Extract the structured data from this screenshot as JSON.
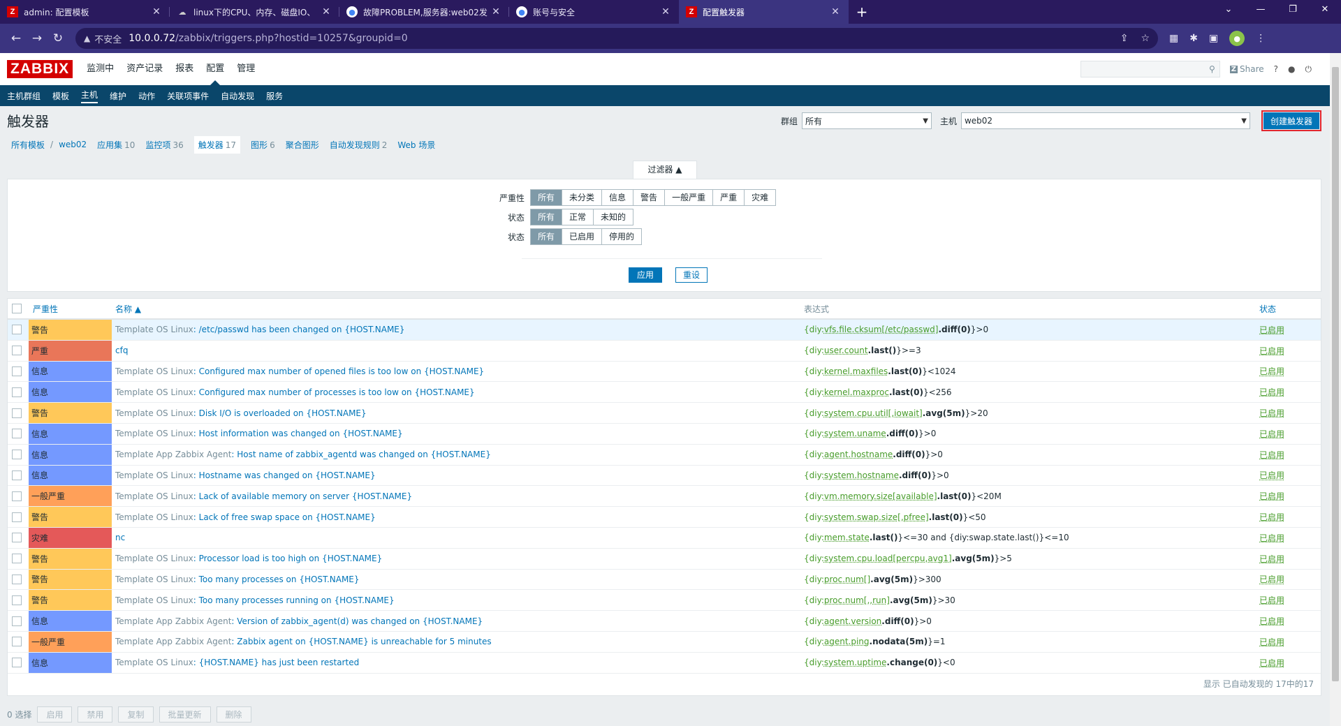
{
  "browser": {
    "tabs": [
      {
        "icon": "zabbix-favicon",
        "title": "admin: 配置模板",
        "active": false
      },
      {
        "icon": "cloud-favicon",
        "title": "linux下的CPU、内存、磁盘IO、",
        "active": false
      },
      {
        "icon": "chrome-favicon",
        "title": "故障PROBLEM,服务器:web02发",
        "active": false
      },
      {
        "icon": "chrome-favicon",
        "title": "账号与安全",
        "active": false
      },
      {
        "icon": "zabbix-favicon",
        "title": "配置触发器",
        "active": true
      }
    ],
    "insecure_label": "不安全",
    "url_host": "10.0.0.72",
    "url_path": "/zabbix/triggers.php?hostid=10257&groupid=0"
  },
  "app": {
    "logo": "ZABBIX",
    "main_menu": [
      "监测中",
      "资产记录",
      "报表",
      "配置",
      "管理"
    ],
    "main_menu_selected": "配置",
    "share_label": "Share",
    "sub_menu": [
      "主机群组",
      "模板",
      "主机",
      "维护",
      "动作",
      "关联项事件",
      "自动发现",
      "服务"
    ],
    "sub_menu_selected": "主机",
    "page_title": "触发器",
    "group_label": "群组",
    "group_value": "所有",
    "host_label": "主机",
    "host_value": "web02",
    "create_button": "创建触发器",
    "breadcrumbs": {
      "all_templates": "所有模板",
      "host": "web02",
      "apps": "应用集",
      "apps_count": "10",
      "items": "监控项",
      "items_count": "36",
      "triggers": "触发器",
      "triggers_count": "17",
      "graphs": "图形",
      "graphs_count": "6",
      "screens": "聚合图形",
      "discovery": "自动发现规则",
      "discovery_count": "2",
      "web": "Web 场景"
    },
    "filter": {
      "tab_label": "过滤器 ▲",
      "severity_label": "严重性",
      "severity_options": [
        "所有",
        "未分类",
        "信息",
        "警告",
        "一般严重",
        "严重",
        "灾难"
      ],
      "state_label": "状态",
      "state_options": [
        "所有",
        "正常",
        "未知的"
      ],
      "status_label": "状态",
      "status_options": [
        "所有",
        "已启用",
        "停用的"
      ],
      "apply": "应用",
      "reset": "重设"
    },
    "table": {
      "headers": {
        "severity": "严重性",
        "name": "名称 ▲",
        "expression": "表达式",
        "status": "状态"
      },
      "rows": [
        {
          "sev": "警告",
          "tpl": "Template OS Linux",
          "name": "/etc/passwd has been changed on {HOST.NAME}",
          "host": "{diy:",
          "key": "vfs.file.cksum[/etc/passwd]",
          "fn": ".diff(0)",
          "rest": "}>0",
          "status": "已启用"
        },
        {
          "sev": "严重",
          "tpl": "",
          "name": "cfq",
          "host": "{diy:",
          "key": "user.count",
          "fn": ".last()",
          "rest": "}>=3",
          "status": "已启用"
        },
        {
          "sev": "信息",
          "tpl": "Template OS Linux",
          "name": "Configured max number of opened files is too low on {HOST.NAME}",
          "host": "{diy:",
          "key": "kernel.maxfiles",
          "fn": ".last(0)",
          "rest": "}<1024",
          "status": "已启用"
        },
        {
          "sev": "信息",
          "tpl": "Template OS Linux",
          "name": "Configured max number of processes is too low on {HOST.NAME}",
          "host": "{diy:",
          "key": "kernel.maxproc",
          "fn": ".last(0)",
          "rest": "}<256",
          "status": "已启用"
        },
        {
          "sev": "警告",
          "tpl": "Template OS Linux",
          "name": "Disk I/O is overloaded on {HOST.NAME}",
          "host": "{diy:",
          "key": "system.cpu.util[,iowait]",
          "fn": ".avg(5m)",
          "rest": "}>20",
          "status": "已启用"
        },
        {
          "sev": "信息",
          "tpl": "Template OS Linux",
          "name": "Host information was changed on {HOST.NAME}",
          "host": "{diy:",
          "key": "system.uname",
          "fn": ".diff(0)",
          "rest": "}>0",
          "status": "已启用"
        },
        {
          "sev": "信息",
          "tpl": "Template App Zabbix Agent",
          "name": "Host name of zabbix_agentd was changed on {HOST.NAME}",
          "host": "{diy:",
          "key": "agent.hostname",
          "fn": ".diff(0)",
          "rest": "}>0",
          "status": "已启用"
        },
        {
          "sev": "信息",
          "tpl": "Template OS Linux",
          "name": "Hostname was changed on {HOST.NAME}",
          "host": "{diy:",
          "key": "system.hostname",
          "fn": ".diff(0)",
          "rest": "}>0",
          "status": "已启用"
        },
        {
          "sev": "一般严重",
          "tpl": "Template OS Linux",
          "name": "Lack of available memory on server {HOST.NAME}",
          "host": "{diy:",
          "key": "vm.memory.size[available]",
          "fn": ".last(0)",
          "rest": "}<20M",
          "status": "已启用"
        },
        {
          "sev": "警告",
          "tpl": "Template OS Linux",
          "name": "Lack of free swap space on {HOST.NAME}",
          "host": "{diy:",
          "key": "system.swap.size[,pfree]",
          "fn": ".last(0)",
          "rest": "}<50",
          "status": "已启用"
        },
        {
          "sev": "灾难",
          "tpl": "",
          "name": "nc",
          "host": "{diy:",
          "key": "mem.state",
          "fn": ".last()",
          "rest": "}<=30 and {diy:swap.state.last()}<=10",
          "status": "已启用"
        },
        {
          "sev": "警告",
          "tpl": "Template OS Linux",
          "name": "Processor load is too high on {HOST.NAME}",
          "host": "{diy:",
          "key": "system.cpu.load[percpu,avg1]",
          "fn": ".avg(5m)",
          "rest": "}>5",
          "status": "已启用"
        },
        {
          "sev": "警告",
          "tpl": "Template OS Linux",
          "name": "Too many processes on {HOST.NAME}",
          "host": "{diy:",
          "key": "proc.num[]",
          "fn": ".avg(5m)",
          "rest": "}>300",
          "status": "已启用"
        },
        {
          "sev": "警告",
          "tpl": "Template OS Linux",
          "name": "Too many processes running on {HOST.NAME}",
          "host": "{diy:",
          "key": "proc.num[,,run]",
          "fn": ".avg(5m)",
          "rest": "}>30",
          "status": "已启用"
        },
        {
          "sev": "信息",
          "tpl": "Template App Zabbix Agent",
          "name": "Version of zabbix_agent(d) was changed on {HOST.NAME}",
          "host": "{diy:",
          "key": "agent.version",
          "fn": ".diff(0)",
          "rest": "}>0",
          "status": "已启用"
        },
        {
          "sev": "一般严重",
          "tpl": "Template App Zabbix Agent",
          "name": "Zabbix agent on {HOST.NAME} is unreachable for 5 minutes",
          "host": "{diy:",
          "key": "agent.ping",
          "fn": ".nodata(5m)",
          "rest": "}=1",
          "status": "已启用"
        },
        {
          "sev": "信息",
          "tpl": "Template OS Linux",
          "name": "{HOST.NAME} has just been restarted",
          "host": "{diy:",
          "key": "system.uptime",
          "fn": ".change(0)",
          "rest": "}<0",
          "status": "已启用"
        }
      ],
      "footer": "显示 已自动发现的 17中的17"
    },
    "actions": {
      "selected": "0 选择",
      "enable": "启用",
      "disable": "禁用",
      "copy": "复制",
      "mass_update": "批量更新",
      "delete": "删除"
    },
    "severity_colors": {
      "警告": "#ffc859",
      "严重": "#e97659",
      "信息": "#7499ff",
      "一般严重": "#ffa059",
      "灾难": "#e45959"
    }
  }
}
